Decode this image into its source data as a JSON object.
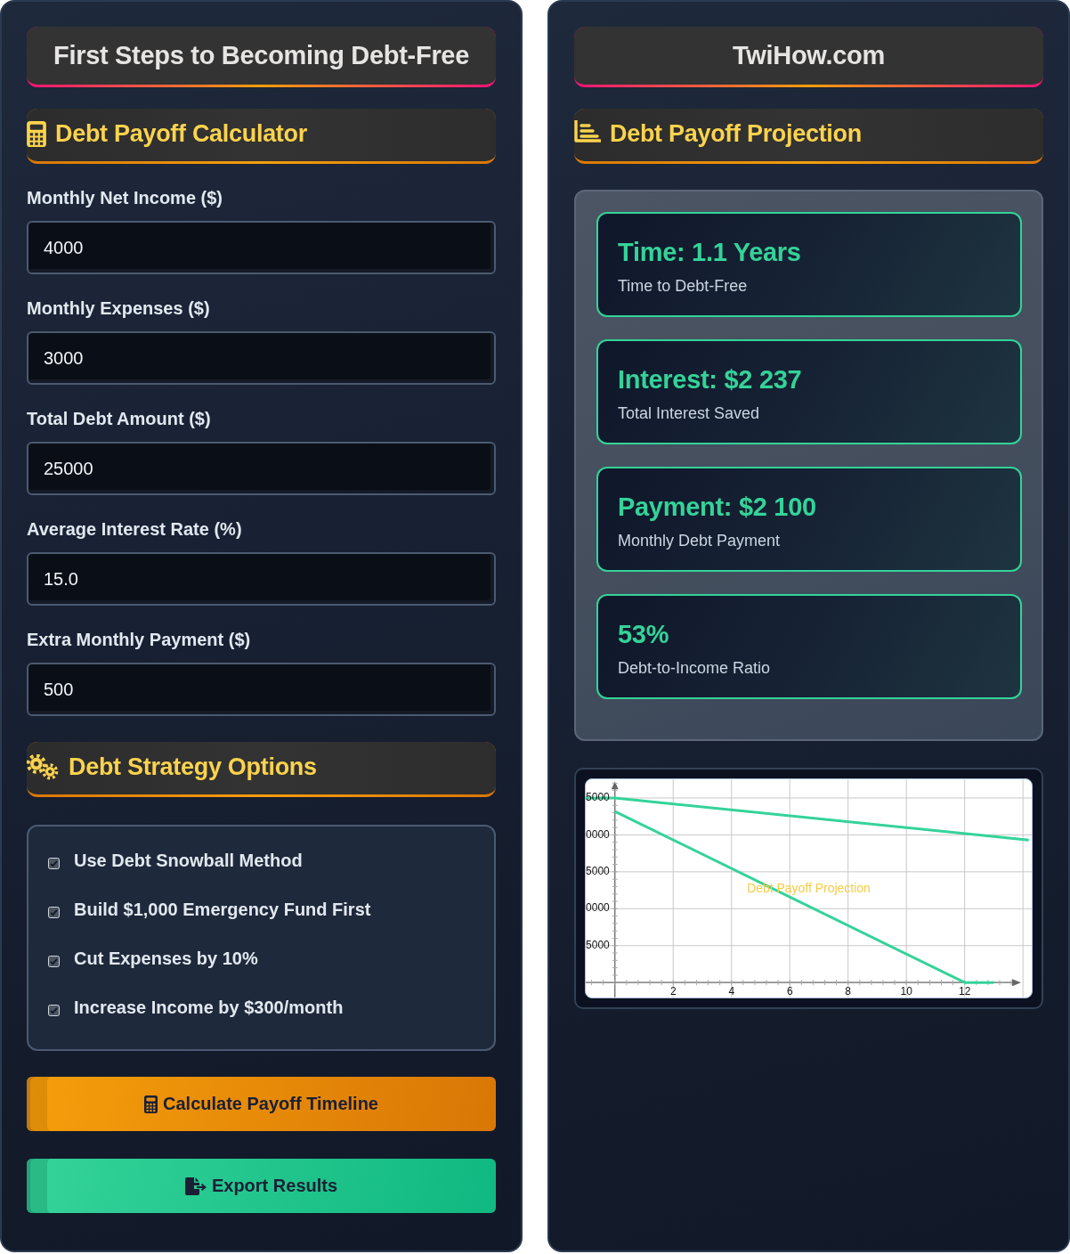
{
  "left_panel": {
    "title": "First Steps to Becoming Debt-Free",
    "calculator_section": {
      "heading": "Debt Payoff Calculator"
    },
    "fields": [
      {
        "label": "Monthly Net Income ($)",
        "value": "4000"
      },
      {
        "label": "Monthly Expenses ($)",
        "value": "3000"
      },
      {
        "label": "Total Debt Amount ($)",
        "value": "25000"
      },
      {
        "label": "Average Interest Rate (%)",
        "value": "15.0"
      },
      {
        "label": "Extra Monthly Payment ($)",
        "value": "500"
      }
    ],
    "strategy_section": {
      "heading": "Debt Strategy Options"
    },
    "strategies": [
      {
        "label": "Use Debt Snowball Method",
        "checked": true
      },
      {
        "label": "Build $1,000 Emergency Fund First",
        "checked": true
      },
      {
        "label": "Cut Expenses by 10%",
        "checked": true
      },
      {
        "label": "Increase Income by $300/month",
        "checked": true
      }
    ],
    "buttons": [
      {
        "label": "Calculate Payoff Timeline",
        "kind": "calculate"
      },
      {
        "label": "Export Results",
        "kind": "export"
      }
    ]
  },
  "right_panel": {
    "title": "TwiHow.com",
    "projection_section": {
      "heading": "Debt Payoff Projection"
    },
    "stats": [
      {
        "value": "Time: 1.1 Years",
        "label": "Time to Debt-Free"
      },
      {
        "value": "Interest: $2 237",
        "label": "Total Interest Saved"
      },
      {
        "value": "Payment: $2 100",
        "label": "Monthly Debt Payment"
      },
      {
        "value": "53%",
        "label": "Debt-to-Income Ratio"
      }
    ],
    "chart": {
      "title": "Debt Payoff Projection",
      "y_tick_labels": [
        "5000",
        "0000",
        "5000",
        "0000",
        "5000"
      ],
      "x_tick_labels": [
        "2",
        "4",
        "6",
        "8",
        "10",
        "12"
      ]
    }
  }
}
